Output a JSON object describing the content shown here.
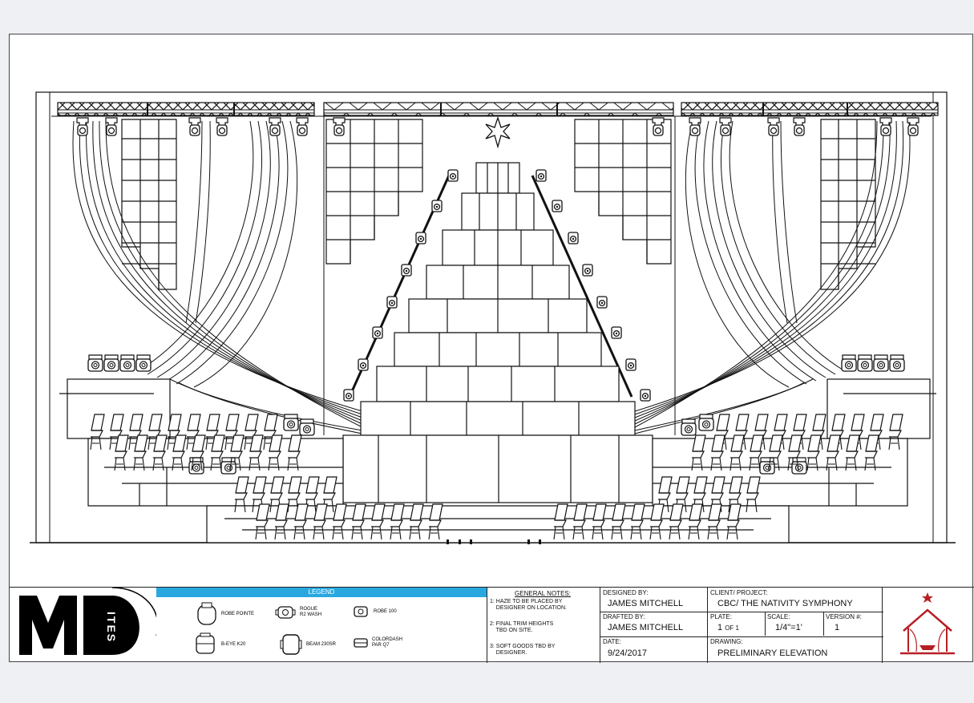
{
  "logo": {
    "wordmark": "ITES"
  },
  "legend": {
    "title": "LEGEND",
    "items": [
      {
        "label": "ROBE POINTE",
        "icon": "robe-pointe-icon"
      },
      {
        "label": "ROGUE\nR2 WASH",
        "icon": "rogue-wash-icon"
      },
      {
        "label": "ROBE 100",
        "icon": "robe-100-icon"
      },
      {
        "label": "B-EYE K20",
        "icon": "beye-k20-icon"
      },
      {
        "label": "BEAM 230SR",
        "icon": "beam-230sr-icon"
      },
      {
        "label": "COLORDASH\nPAR Q7",
        "icon": "colordash-par-icon"
      }
    ]
  },
  "notes": {
    "title": "GENERAL NOTES:",
    "items": [
      "1: HAZE TO BE PLACED BY\n    DESIGNER ON LOCATION.",
      "2: FINAL TRIM HEIGHTS\n    TBD ON SITE.",
      "3: SOFT GOODS TBD BY\n    DESIGNER."
    ]
  },
  "designed_by": {
    "label": "DESIGNED BY:",
    "value": "JAMES MITCHELL"
  },
  "drafted_by": {
    "label": "DRAFTED BY:",
    "value": "JAMES MITCHELL"
  },
  "date": {
    "label": "DATE:",
    "value": "9/24/2017"
  },
  "client": {
    "label": "CLIENT/ PROJECT:",
    "value": "CBC/ THE NATIVITY SYMPHONY"
  },
  "plate": {
    "label": "PLATE:",
    "value": "1",
    "of": "OF 1"
  },
  "scale": {
    "label": "SCALE:",
    "value": "1/4\"=1'"
  },
  "version": {
    "label": "VERSION #:",
    "value": "1"
  },
  "drawing": {
    "label": "DRAWING:",
    "value": "PRELIMINARY ELEVATION"
  },
  "colors": {
    "accent": "#29a8e0",
    "logo_red": "#b81e24",
    "ink": "#111111"
  }
}
